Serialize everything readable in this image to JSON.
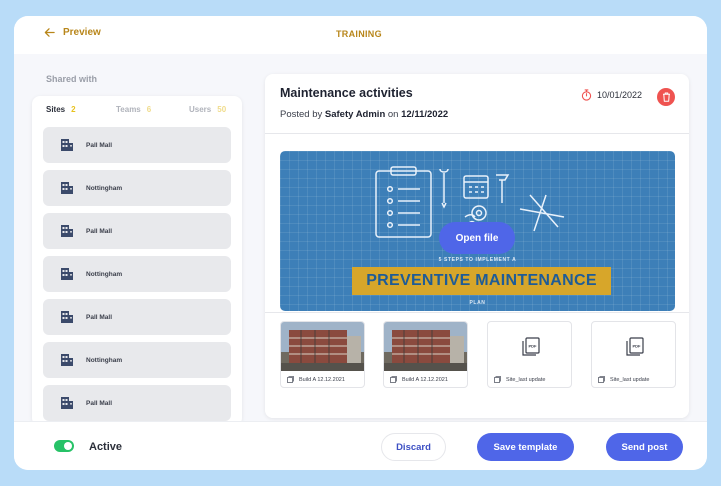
{
  "header": {
    "back_label": "Preview",
    "title": "TRAINING"
  },
  "shared": {
    "label": "Shared with",
    "tabs": [
      {
        "label": "Sites",
        "count": "2"
      },
      {
        "label": "Teams",
        "count": "6"
      },
      {
        "label": "Users",
        "count": "50"
      }
    ],
    "sites": [
      {
        "name": "Pall Mall",
        "icon": "building-icon"
      },
      {
        "name": "Nottingham",
        "icon": "building-icon"
      },
      {
        "name": "Pall Mall",
        "icon": "building-icon"
      },
      {
        "name": "Nottingham",
        "icon": "building-icon"
      },
      {
        "name": "Pall Mall",
        "icon": "building-icon"
      },
      {
        "name": "Nottingham",
        "icon": "building-icon"
      },
      {
        "name": "Pall Mall",
        "icon": "building-icon"
      }
    ]
  },
  "post": {
    "title": "Maintenance activities",
    "posted_prefix": "Posted by",
    "author": "Safety Admin",
    "posted_on": "on",
    "posted_date": "12/11/2022",
    "due_date": "10/01/2022",
    "banner": {
      "subtitle": "5 STEPS TO IMPLEMENT A",
      "headline": "PREVENTIVE MAINTENANCE",
      "tail": "PLAN"
    },
    "open_file_label": "Open file",
    "attachments": [
      {
        "type": "image",
        "name": "Build A 12.12.2021"
      },
      {
        "type": "image",
        "name": "Build A 12.12.2021"
      },
      {
        "type": "pdf",
        "name": "Site_last update"
      },
      {
        "type": "pdf",
        "name": "Site_last update"
      }
    ]
  },
  "footer": {
    "active_label": "Active",
    "discard_label": "Discard",
    "save_label": "Save template",
    "send_label": "Send post"
  },
  "colors": {
    "accent": "#4f66e8",
    "gold": "#b8861a",
    "count_yellow": "#e8c21e",
    "toggle_on": "#27c267",
    "delete_red": "#ef5350",
    "banner_blue": "#3d7fb8"
  }
}
